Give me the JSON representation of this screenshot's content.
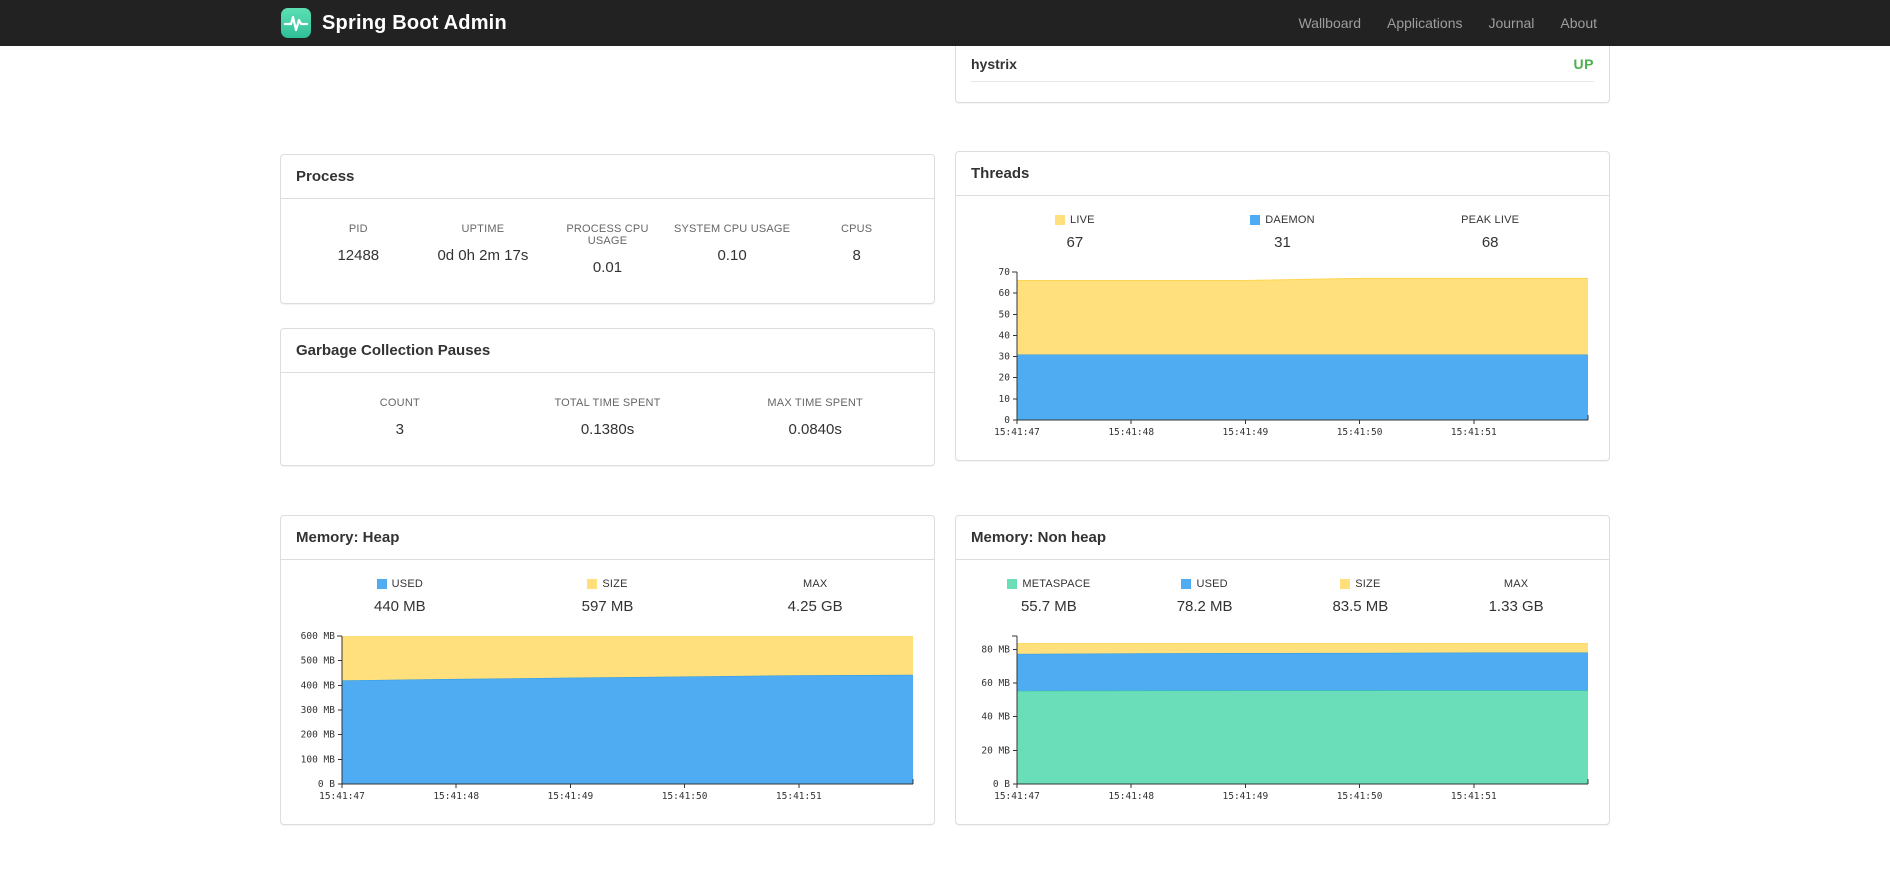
{
  "navbar": {
    "brand": "Spring Boot Admin",
    "links": [
      "Wallboard",
      "Applications",
      "Journal",
      "About"
    ]
  },
  "health": {
    "item": "hystrix",
    "status": "UP",
    "status_color": "#4CAF50"
  },
  "panels": {
    "process": {
      "title": "Process",
      "metrics": [
        {
          "label": "PID",
          "value": "12488"
        },
        {
          "label": "UPTIME",
          "value": "0d 0h 2m 17s"
        },
        {
          "label": "PROCESS CPU USAGE",
          "value": "0.01"
        },
        {
          "label": "SYSTEM CPU USAGE",
          "value": "0.10"
        },
        {
          "label": "CPUS",
          "value": "8"
        }
      ]
    },
    "gc": {
      "title": "Garbage Collection Pauses",
      "metrics": [
        {
          "label": "COUNT",
          "value": "3"
        },
        {
          "label": "TOTAL TIME SPENT",
          "value": "0.1380s"
        },
        {
          "label": "MAX TIME SPENT",
          "value": "0.0840s"
        }
      ]
    },
    "threads": {
      "title": "Threads",
      "legend": [
        {
          "label": "LIVE",
          "value": "67",
          "color": "#FFE07D"
        },
        {
          "label": "DAEMON",
          "value": "31",
          "color": "#4FACF3"
        },
        {
          "label": "PEAK LIVE",
          "value": "68"
        }
      ]
    },
    "heap": {
      "title": "Memory: Heap",
      "legend": [
        {
          "label": "USED",
          "value": "440 MB",
          "color": "#4FACF3"
        },
        {
          "label": "SIZE",
          "value": "597 MB",
          "color": "#FFE07D"
        },
        {
          "label": "MAX",
          "value": "4.25 GB"
        }
      ]
    },
    "nonheap": {
      "title": "Memory: Non heap",
      "legend": [
        {
          "label": "METASPACE",
          "value": "55.7 MB",
          "color": "#69DEB8"
        },
        {
          "label": "USED",
          "value": "78.2 MB",
          "color": "#4FACF3"
        },
        {
          "label": "SIZE",
          "value": "83.5 MB",
          "color": "#FFE07D"
        },
        {
          "label": "MAX",
          "value": "1.33 GB"
        }
      ]
    }
  },
  "chart_data": [
    {
      "id": "threads",
      "type": "area",
      "title": "Threads",
      "x_labels": [
        "15:41:47",
        "15:41:48",
        "15:41:49",
        "15:41:50",
        "15:41:51"
      ],
      "ylim": [
        0,
        70
      ],
      "y_ticks": [
        {
          "v": 0,
          "label": "0"
        },
        {
          "v": 10,
          "label": "10"
        },
        {
          "v": 20,
          "label": "20"
        },
        {
          "v": 30,
          "label": "30"
        },
        {
          "v": 40,
          "label": "40"
        },
        {
          "v": 50,
          "label": "50"
        },
        {
          "v": 60,
          "label": "60"
        },
        {
          "v": 70,
          "label": "70"
        }
      ],
      "series": [
        {
          "name": "DAEMON",
          "color": "#4FACF3",
          "stroke": "#2D9BE0",
          "tops": [
            31,
            31,
            31,
            31,
            31,
            31
          ]
        },
        {
          "name": "LIVE",
          "color": "#FFE07D",
          "stroke": "#FFD54F",
          "tops": [
            66,
            66,
            66,
            67,
            67,
            67
          ]
        }
      ]
    },
    {
      "id": "heap",
      "type": "area",
      "title": "Memory: Heap",
      "x_labels": [
        "15:41:47",
        "15:41:48",
        "15:41:49",
        "15:41:50",
        "15:41:51"
      ],
      "ylim": [
        0,
        600
      ],
      "y_ticks": [
        {
          "v": 0,
          "label": "0 B"
        },
        {
          "v": 100,
          "label": "100 MB"
        },
        {
          "v": 200,
          "label": "200 MB"
        },
        {
          "v": 300,
          "label": "300 MB"
        },
        {
          "v": 400,
          "label": "400 MB"
        },
        {
          "v": 500,
          "label": "500 MB"
        },
        {
          "v": 600,
          "label": "600 MB"
        }
      ],
      "series": [
        {
          "name": "USED",
          "color": "#4FACF3",
          "stroke": "#2D9BE0",
          "tops": [
            420,
            426,
            431,
            436,
            441,
            443
          ]
        },
        {
          "name": "SIZE",
          "color": "#FFE07D",
          "stroke": "#FFD54F",
          "tops": [
            597,
            597,
            597,
            597,
            597,
            597
          ]
        }
      ]
    },
    {
      "id": "nonheap",
      "type": "area",
      "title": "Memory: Non heap",
      "x_labels": [
        "15:41:47",
        "15:41:48",
        "15:41:49",
        "15:41:50",
        "15:41:51"
      ],
      "ylim": [
        0,
        88
      ],
      "y_ticks": [
        {
          "v": 0,
          "label": "0 B"
        },
        {
          "v": 20,
          "label": "20 MB"
        },
        {
          "v": 40,
          "label": "40 MB"
        },
        {
          "v": 60,
          "label": "60 MB"
        },
        {
          "v": 80,
          "label": "80 MB"
        }
      ],
      "series": [
        {
          "name": "METASPACE",
          "color": "#69DEB8",
          "stroke": "#30C893",
          "tops": [
            55.4,
            55.5,
            55.6,
            55.6,
            55.7,
            55.7
          ]
        },
        {
          "name": "USED",
          "color": "#4FACF3",
          "stroke": "#2D9BE0",
          "tops": [
            77.4,
            77.7,
            77.9,
            78.0,
            78.2,
            78.2
          ]
        },
        {
          "name": "SIZE",
          "color": "#FFE07D",
          "stroke": "#FFD54F",
          "tops": [
            83.5,
            83.5,
            83.5,
            83.5,
            83.5,
            83.5
          ]
        }
      ]
    }
  ]
}
